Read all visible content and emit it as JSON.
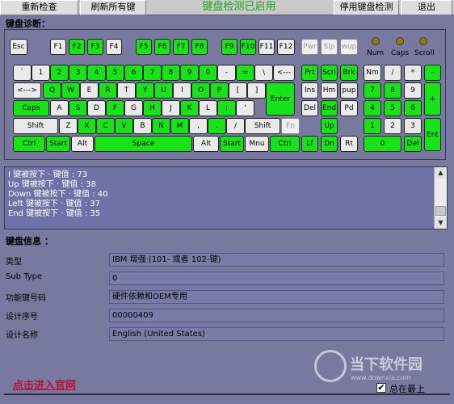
{
  "toolbar": {
    "recheck": "重新检查",
    "refresh_keys": "刷新所有键",
    "status": "键盘检测已启用",
    "stop": "停用键盘检测",
    "exit": "退出"
  },
  "keyboard": {
    "title": "键盘诊断：",
    "leds": [
      "Num",
      "Caps",
      "Scroll"
    ],
    "keys": [
      {
        "label": "Esc",
        "state": "normal"
      },
      {
        "label": "F1",
        "state": "normal"
      },
      {
        "label": "F2",
        "state": "on"
      },
      {
        "label": "F3",
        "state": "on"
      },
      {
        "label": "F4",
        "state": "normal"
      },
      {
        "label": "F5",
        "state": "on"
      },
      {
        "label": "F6",
        "state": "on"
      },
      {
        "label": "F7",
        "state": "on"
      },
      {
        "label": "F8",
        "state": "on"
      },
      {
        "label": "F9",
        "state": "on"
      },
      {
        "label": "F10",
        "state": "on"
      },
      {
        "label": "F11",
        "state": "normal"
      },
      {
        "label": "F12",
        "state": "normal"
      },
      {
        "label": "Pwr",
        "state": "off"
      },
      {
        "label": "Slp",
        "state": "off"
      },
      {
        "label": "wup",
        "state": "off"
      },
      {
        "label": "`",
        "state": "normal"
      },
      {
        "label": "1",
        "state": "normal"
      },
      {
        "label": "2",
        "state": "on"
      },
      {
        "label": "3",
        "state": "on"
      },
      {
        "label": "4",
        "state": "on"
      },
      {
        "label": "5",
        "state": "on"
      },
      {
        "label": "6",
        "state": "on"
      },
      {
        "label": "7",
        "state": "on"
      },
      {
        "label": "8",
        "state": "on"
      },
      {
        "label": "9",
        "state": "on"
      },
      {
        "label": "0",
        "state": "on"
      },
      {
        "label": "-",
        "state": "normal"
      },
      {
        "label": "=",
        "state": "on"
      },
      {
        "label": "\\",
        "state": "normal"
      },
      {
        "label": "<---",
        "state": "normal"
      },
      {
        "label": "Prt",
        "state": "on"
      },
      {
        "label": "Scrl",
        "state": "on"
      },
      {
        "label": "Brk",
        "state": "on"
      },
      {
        "label": "Nm",
        "state": "normal"
      },
      {
        "label": "/",
        "state": "normal"
      },
      {
        "label": "*",
        "state": "normal"
      },
      {
        "label": "-",
        "state": "on"
      },
      {
        "label": "<--->",
        "state": "normal"
      },
      {
        "label": "Q",
        "state": "on"
      },
      {
        "label": "W",
        "state": "on"
      },
      {
        "label": "E",
        "state": "normal"
      },
      {
        "label": "R",
        "state": "on"
      },
      {
        "label": "T",
        "state": "normal"
      },
      {
        "label": "Y",
        "state": "on"
      },
      {
        "label": "U",
        "state": "on"
      },
      {
        "label": "I",
        "state": "normal"
      },
      {
        "label": "O",
        "state": "on"
      },
      {
        "label": "P",
        "state": "on"
      },
      {
        "label": "[",
        "state": "normal"
      },
      {
        "label": "]",
        "state": "normal"
      },
      {
        "label": "Enter",
        "state": "on"
      },
      {
        "label": "Ins",
        "state": "normal"
      },
      {
        "label": "Hm",
        "state": "normal"
      },
      {
        "label": "pup",
        "state": "normal"
      },
      {
        "label": "7",
        "state": "on"
      },
      {
        "label": "8",
        "state": "on"
      },
      {
        "label": "9",
        "state": "normal"
      },
      {
        "label": "+",
        "state": "on"
      },
      {
        "label": "Caps",
        "state": "on"
      },
      {
        "label": "A",
        "state": "normal"
      },
      {
        "label": "S",
        "state": "on"
      },
      {
        "label": "D",
        "state": "normal"
      },
      {
        "label": "F",
        "state": "on"
      },
      {
        "label": "G",
        "state": "normal"
      },
      {
        "label": "H",
        "state": "on"
      },
      {
        "label": "J",
        "state": "normal"
      },
      {
        "label": "K",
        "state": "on"
      },
      {
        "label": "L",
        "state": "normal"
      },
      {
        "label": ";",
        "state": "on"
      },
      {
        "label": "'",
        "state": "normal"
      },
      {
        "label": "Del",
        "state": "normal"
      },
      {
        "label": "End",
        "state": "on"
      },
      {
        "label": "Pd",
        "state": "normal"
      },
      {
        "label": "4",
        "state": "on"
      },
      {
        "label": "5",
        "state": "on"
      },
      {
        "label": "6",
        "state": "on"
      },
      {
        "label": "Shift",
        "state": "normal"
      },
      {
        "label": "Z",
        "state": "normal"
      },
      {
        "label": "X",
        "state": "on"
      },
      {
        "label": "C",
        "state": "on"
      },
      {
        "label": "V",
        "state": "on"
      },
      {
        "label": "B",
        "state": "normal"
      },
      {
        "label": "N",
        "state": "on"
      },
      {
        "label": "M",
        "state": "on"
      },
      {
        "label": ",",
        "state": "normal"
      },
      {
        "label": ".",
        "state": "on"
      },
      {
        "label": "/",
        "state": "normal"
      },
      {
        "label": "Shift",
        "state": "normal"
      },
      {
        "label": "Fn",
        "state": "off"
      },
      {
        "label": "Up",
        "state": "on"
      },
      {
        "label": "1",
        "state": "on"
      },
      {
        "label": "2",
        "state": "normal"
      },
      {
        "label": "3",
        "state": "normal"
      },
      {
        "label": "Ent",
        "state": "on"
      },
      {
        "label": "Ctrl",
        "state": "on"
      },
      {
        "label": "Start",
        "state": "on"
      },
      {
        "label": "Alt",
        "state": "normal"
      },
      {
        "label": "Space",
        "state": "on"
      },
      {
        "label": "Alt",
        "state": "normal"
      },
      {
        "label": "Start",
        "state": "on"
      },
      {
        "label": "Mnu",
        "state": "normal"
      },
      {
        "label": "Ctrl",
        "state": "on"
      },
      {
        "label": "Lf",
        "state": "on"
      },
      {
        "label": "Dn",
        "state": "on"
      },
      {
        "label": "Rt",
        "state": "normal"
      },
      {
        "label": "0",
        "state": "on"
      },
      {
        "label": "Del",
        "state": "on"
      }
    ]
  },
  "log": {
    "lines": [
      "I 键被按下 · 键值 : 73",
      "Up 键被按下 · 键值 : 38",
      "Down 键被按下 · 键值 : 40",
      "Left 键被按下 · 键值 : 37",
      "End 键被按下 · 键值 : 35"
    ]
  },
  "info": {
    "title": "键盘信息 ：",
    "rows": [
      {
        "label": "类型",
        "value": "IBM 增强 (101- 或者 102-键)"
      },
      {
        "label": "Sub Type",
        "value": "0"
      },
      {
        "label": "功能键号码",
        "value": "硬件依赖和OEM专用"
      },
      {
        "label": "设计序号",
        "value": "00000409"
      },
      {
        "label": "设计名称",
        "value": "English (United States)"
      }
    ]
  },
  "footer": {
    "link": "点击进入官网",
    "checkbox_label": "总在最上",
    "checkbox_checked": true,
    "watermark": "当下软件园",
    "watermark_url": "www.downxia.com"
  },
  "colors": {
    "background": "#77799f",
    "key_pressed": "#18e318",
    "key_normal": "#eaeaea",
    "status_text": "#1fa81f",
    "link": "#b8123a"
  }
}
